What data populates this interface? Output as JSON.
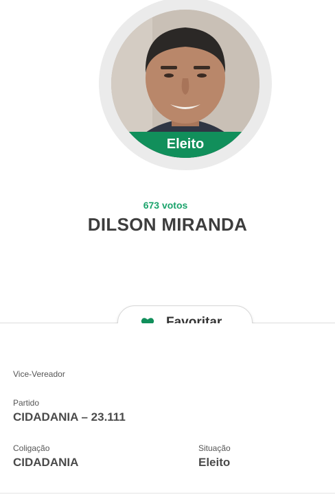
{
  "candidate": {
    "status": "Eleito",
    "votes": "673 votos",
    "name": "DILSON MIRANDA"
  },
  "actions": {
    "favorite_label": "Favoritar",
    "favorite_icon": "heart-icon",
    "favorite_color": "#118f5b"
  },
  "details": {
    "role": "Vice-Vereador",
    "party_label": "Partido",
    "party_value": "CIDADANIA – 23.111",
    "coalition_label": "Coligação",
    "coalition_value": "CIDADANIA",
    "situation_label": "Situação",
    "situation_value": "Eleito"
  },
  "colors": {
    "accent_green": "#118f5b",
    "votes_green": "#1aa36b"
  }
}
